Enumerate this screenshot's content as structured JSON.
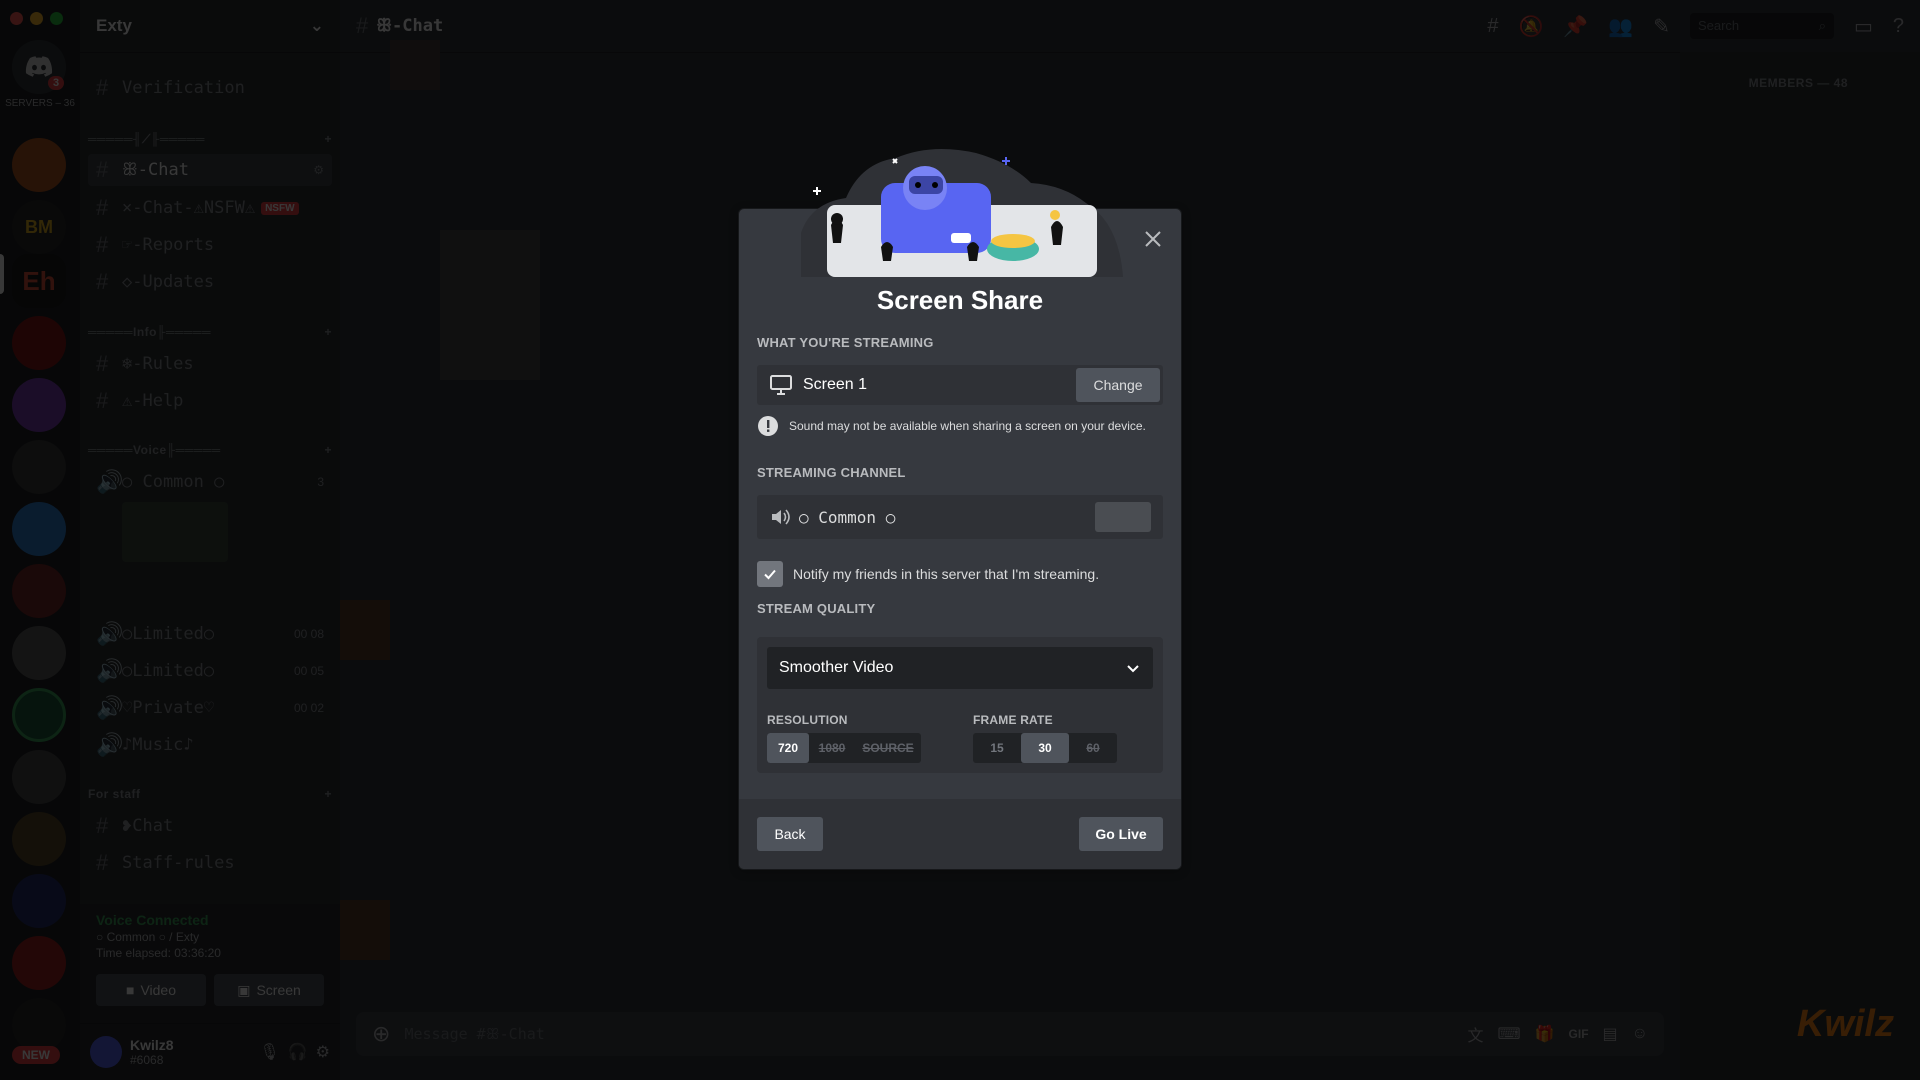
{
  "window": {
    "traffic_lights": [
      "#ff5f57",
      "#febc2e",
      "#28c840"
    ]
  },
  "guilds": {
    "servers_label": "SERVERS – 36",
    "home_badge": "3",
    "new_badge": "NEW",
    "icons": [
      "BM",
      "Eh"
    ]
  },
  "sidebar": {
    "server_name": "Exty",
    "channels": {
      "verification": "Verification",
      "cat_main": "═════╢⟋╟═════",
      "chat": "ꕥ-Chat",
      "chat_nsfw": "⨯-Chat-⚠NSFW⚠",
      "nsfw_tag": "NSFW",
      "reports": "☞-Reports",
      "updates": "◇-Updates",
      "cat_info": "═════Info╟═════",
      "rules": "❄-Rules",
      "help": "⚠-Help",
      "cat_voice": "═════Voice╟═════",
      "common": "○ Common ○",
      "common_count": "3",
      "limited1": "○Limited○",
      "limited1_count": "00 08",
      "limited2": "○Limited○",
      "limited2_count": "00 05",
      "private": "♡Private♡",
      "private_count": "00 02",
      "music": "♪Music♪",
      "cat_staff": "For staff",
      "staff_chat": "❥Chat",
      "staff_rules": "Staff-rules"
    },
    "voice_panel": {
      "status": "Voice Connected",
      "channel": "○ Common ○ / Exty",
      "elapsed": "Time elapsed: 03:36:20",
      "video_label": "Video",
      "screen_label": "Screen"
    },
    "user": {
      "name": "Kwilz8",
      "tag": "#6068"
    }
  },
  "main": {
    "channel_title": "ꕥ-Chat",
    "search_placeholder": "Search",
    "members_title": "MEMBERS — 48",
    "composer_placeholder": "Message #ꕥ-Chat",
    "watermark": "Kwilz"
  },
  "modal": {
    "title": "Screen Share",
    "streaming_label": "WHAT YOU'RE STREAMING",
    "source_name": "Screen 1",
    "change_label": "Change",
    "warning": "Sound may not be available when sharing a screen on your device.",
    "channel_label": "STREAMING CHANNEL",
    "channel_name": "○ Common ○",
    "notify_label": "Notify my friends in this server that I'm streaming.",
    "notify_checked": true,
    "quality_label": "STREAM QUALITY",
    "quality_value": "Smoother Video",
    "resolution_label": "RESOLUTION",
    "resolution_options": [
      {
        "label": "720",
        "selected": true,
        "disabled": false
      },
      {
        "label": "1080",
        "selected": false,
        "disabled": true
      },
      {
        "label": "SOURCE",
        "selected": false,
        "disabled": true
      }
    ],
    "framerate_label": "FRAME RATE",
    "framerate_options": [
      {
        "label": "15",
        "selected": false,
        "disabled": false
      },
      {
        "label": "30",
        "selected": true,
        "disabled": false
      },
      {
        "label": "60",
        "selected": false,
        "disabled": true
      }
    ],
    "back_label": "Back",
    "golive_label": "Go Live"
  },
  "colors": {
    "blurple": "#5865f2",
    "green": "#3ba55d",
    "red": "#ed4245"
  }
}
